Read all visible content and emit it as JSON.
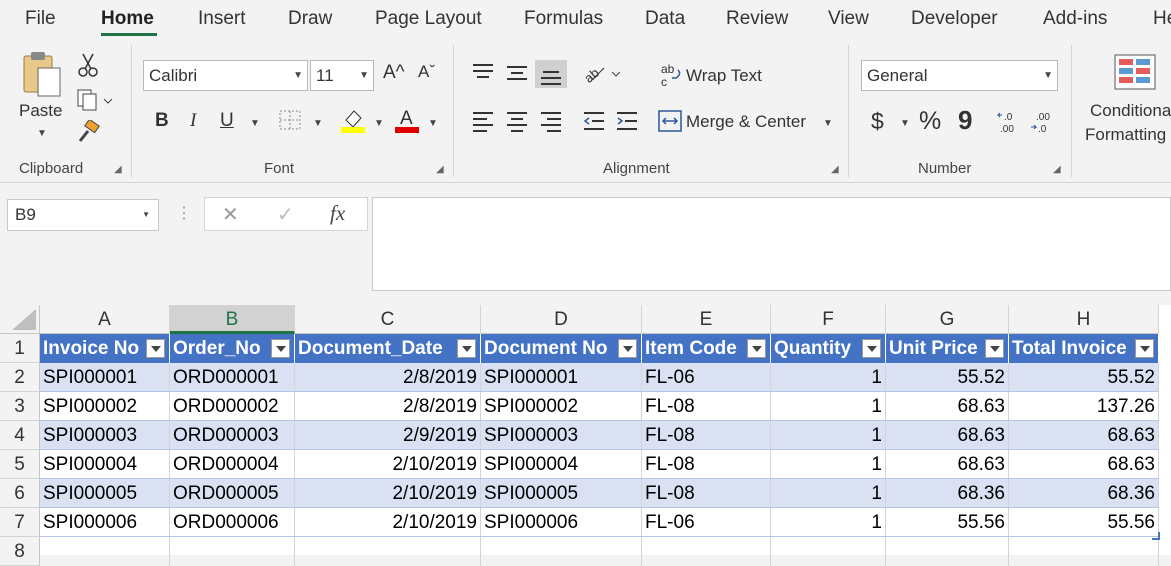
{
  "menu": {
    "tabs": [
      {
        "label": "File",
        "active": false
      },
      {
        "label": "Home",
        "active": true
      },
      {
        "label": "Insert",
        "active": false
      },
      {
        "label": "Draw",
        "active": false
      },
      {
        "label": "Page Layout",
        "active": false
      },
      {
        "label": "Formulas",
        "active": false
      },
      {
        "label": "Data",
        "active": false
      },
      {
        "label": "Review",
        "active": false
      },
      {
        "label": "View",
        "active": false
      },
      {
        "label": "Developer",
        "active": false
      },
      {
        "label": "Add-ins",
        "active": false
      },
      {
        "label": "He",
        "active": false
      }
    ]
  },
  "ribbon": {
    "clipboard": {
      "label": "Clipboard",
      "paste_label": "Paste"
    },
    "font": {
      "label": "Font",
      "font_name": "Calibri",
      "font_size": "11",
      "bold": "B",
      "italic": "I",
      "underline": "U",
      "grow": "A^",
      "shrink": "Aˇ"
    },
    "alignment": {
      "label": "Alignment",
      "wrap_text": "Wrap Text",
      "merge_center": "Merge & Center"
    },
    "number": {
      "label": "Number",
      "format": "General",
      "currency": "$",
      "percent": "%",
      "comma": "9"
    },
    "styles": {
      "conditional_line1": "Conditiona",
      "conditional_line2": "Formatting"
    }
  },
  "formula_bar": {
    "name_box": "B9",
    "cancel": "✕",
    "enter": "✓",
    "fx": "fx",
    "content": ""
  },
  "sheet": {
    "columns": [
      "A",
      "B",
      "C",
      "D",
      "E",
      "F",
      "G",
      "H"
    ],
    "selected_column": "B",
    "row_numbers": [
      "1",
      "2",
      "3",
      "4",
      "5",
      "6",
      "7",
      "8"
    ],
    "headers": [
      "Invoice No",
      "Order_No",
      "Document_Date",
      "Document No",
      "Item Code",
      "Quantity",
      "Unit Price",
      "Total Invoice"
    ],
    "rows": [
      [
        "SPI000001",
        "ORD000001",
        "2/8/2019",
        "SPI000001",
        "FL-06",
        "1",
        "55.52",
        "55.52"
      ],
      [
        "SPI000002",
        "ORD000002",
        "2/8/2019",
        "SPI000002",
        "FL-08",
        "1",
        "68.63",
        "137.26"
      ],
      [
        "SPI000003",
        "ORD000003",
        "2/9/2019",
        "SPI000003",
        "FL-08",
        "1",
        "68.63",
        "68.63"
      ],
      [
        "SPI000004",
        "ORD000004",
        "2/10/2019",
        "SPI000004",
        "FL-08",
        "1",
        "68.63",
        "68.63"
      ],
      [
        "SPI000005",
        "ORD000005",
        "2/10/2019",
        "SPI000005",
        "FL-08",
        "1",
        "68.36",
        "68.36"
      ],
      [
        "SPI000006",
        "ORD000006",
        "2/10/2019",
        "SPI000006",
        "FL-06",
        "1",
        "55.56",
        "55.56"
      ]
    ],
    "colors": {
      "table_header": "#4472c4",
      "band": "#d9e1f2",
      "accent": "#217346"
    }
  }
}
